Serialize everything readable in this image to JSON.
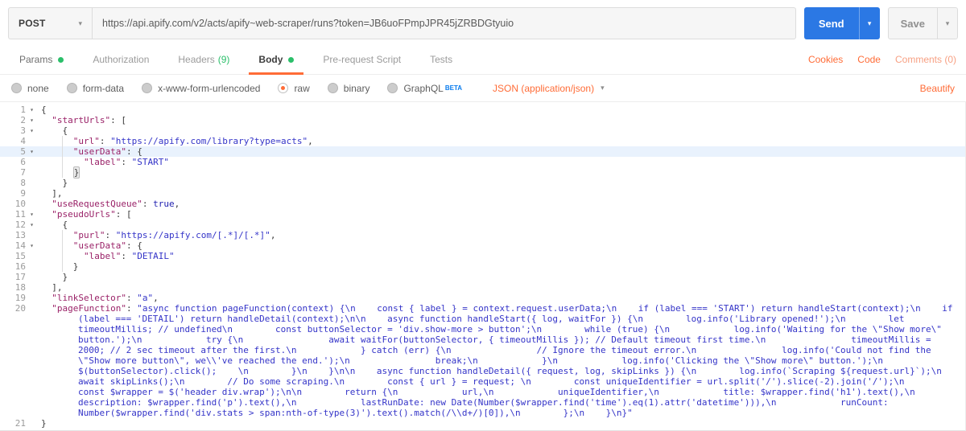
{
  "request": {
    "method": "POST",
    "url": "https://api.apify.com/v2/acts/apify~web-scraper/runs?token=JB6uoFPmpJPR45jZRBDGtyuio",
    "send_label": "Send",
    "save_label": "Save"
  },
  "tabs": [
    {
      "label": "Params",
      "dot": true,
      "first": true
    },
    {
      "label": "Authorization"
    },
    {
      "label": "Headers",
      "badge": "(9)"
    },
    {
      "label": "Body",
      "dot": true,
      "active": true
    },
    {
      "label": "Pre-request Script"
    },
    {
      "label": "Tests"
    }
  ],
  "tab_links": {
    "cookies": "Cookies",
    "code": "Code",
    "comments": "Comments (0)"
  },
  "body_modes": [
    {
      "label": "none"
    },
    {
      "label": "form-data"
    },
    {
      "label": "x-www-form-urlencoded"
    },
    {
      "label": "raw",
      "selected": true
    },
    {
      "label": "binary"
    },
    {
      "label": "GraphQL",
      "beta": "BETA"
    }
  ],
  "content_type": "JSON (application/json)",
  "beautify_label": "Beautify",
  "colors": {
    "accent_orange": "#ff6c37",
    "green_dot": "#2bbf6a",
    "send_blue": "#2b78e4",
    "beta_blue": "#097bed"
  },
  "editor": {
    "lines": [
      {
        "n": 1,
        "fold": true,
        "tokens": [
          [
            "p",
            "{"
          ]
        ]
      },
      {
        "n": 2,
        "fold": true,
        "tokens": [
          [
            "p",
            "  "
          ],
          [
            "k",
            "\"startUrls\""
          ],
          [
            "p",
            ": ["
          ]
        ]
      },
      {
        "n": 3,
        "fold": true,
        "tokens": [
          [
            "p",
            "    {"
          ]
        ]
      },
      {
        "n": 4,
        "g": true,
        "tokens": [
          [
            "p",
            "      "
          ],
          [
            "k",
            "\"url\""
          ],
          [
            "p",
            ": "
          ],
          [
            "s",
            "\"https://apify.com/library?type=acts\""
          ],
          [
            "p",
            ","
          ]
        ]
      },
      {
        "n": 5,
        "fold": true,
        "active": true,
        "g": true,
        "tokens": [
          [
            "p",
            "      "
          ],
          [
            "k",
            "\"userData\""
          ],
          [
            "p",
            ": {"
          ]
        ]
      },
      {
        "n": 6,
        "g": true,
        "tokens": [
          [
            "p",
            "        "
          ],
          [
            "k",
            "\"label\""
          ],
          [
            "p",
            ": "
          ],
          [
            "s",
            "\"START\""
          ]
        ]
      },
      {
        "n": 7,
        "g": true,
        "tokens": [
          [
            "p",
            "      "
          ],
          [
            "pm",
            "}"
          ]
        ]
      },
      {
        "n": 8,
        "tokens": [
          [
            "p",
            "    }"
          ]
        ]
      },
      {
        "n": 9,
        "tokens": [
          [
            "p",
            "  ],"
          ]
        ]
      },
      {
        "n": 10,
        "tokens": [
          [
            "p",
            "  "
          ],
          [
            "k",
            "\"useRequestQueue\""
          ],
          [
            "p",
            ": "
          ],
          [
            "a",
            "true"
          ],
          [
            "p",
            ","
          ]
        ]
      },
      {
        "n": 11,
        "fold": true,
        "tokens": [
          [
            "p",
            "  "
          ],
          [
            "k",
            "\"pseudoUrls\""
          ],
          [
            "p",
            ": ["
          ]
        ]
      },
      {
        "n": 12,
        "fold": true,
        "tokens": [
          [
            "p",
            "    {"
          ]
        ]
      },
      {
        "n": 13,
        "g": true,
        "tokens": [
          [
            "p",
            "      "
          ],
          [
            "k",
            "\"purl\""
          ],
          [
            "p",
            ": "
          ],
          [
            "s",
            "\"https://apify.com/[.*]/[.*]\""
          ],
          [
            "p",
            ","
          ]
        ]
      },
      {
        "n": 14,
        "fold": true,
        "g": true,
        "tokens": [
          [
            "p",
            "      "
          ],
          [
            "k",
            "\"userData\""
          ],
          [
            "p",
            ": {"
          ]
        ]
      },
      {
        "n": 15,
        "g": true,
        "tokens": [
          [
            "p",
            "        "
          ],
          [
            "k",
            "\"label\""
          ],
          [
            "p",
            ": "
          ],
          [
            "s",
            "\"DETAIL\""
          ]
        ]
      },
      {
        "n": 16,
        "g": true,
        "tokens": [
          [
            "p",
            "      }"
          ]
        ]
      },
      {
        "n": 17,
        "tokens": [
          [
            "p",
            "    }"
          ]
        ]
      },
      {
        "n": 18,
        "tokens": [
          [
            "p",
            "  ],"
          ]
        ]
      },
      {
        "n": 19,
        "tokens": [
          [
            "p",
            "  "
          ],
          [
            "k",
            "\"linkSelector\""
          ],
          [
            "p",
            ": "
          ],
          [
            "s",
            "\"a\""
          ],
          [
            "p",
            ","
          ]
        ]
      },
      {
        "n": 20,
        "wrap": true,
        "tokens": [
          [
            "p",
            "  "
          ],
          [
            "k",
            "\"pageFunction\""
          ],
          [
            "p",
            ": "
          ],
          [
            "s",
            "\"async function pageFunction(context) {\\n    const { label } = context.request.userData;\\n    if (label === 'START') return handleStart(context);\\n    if (label === 'DETAIL') return handleDetail(context);\\n\\n    async function handleStart({ log, waitFor }) {\\n        log.info('Library opened!');\\n        let timeoutMillis; // undefined\\n        const buttonSelector = 'div.show-more > button';\\n        while (true) {\\n            log.info('Waiting for the \\\"Show more\\\" button.');\\n            try {\\n                await waitFor(buttonSelector, { timeoutMillis }); // Default timeout first time.\\n                timeoutMillis = 2000; // 2 sec timeout after the first.\\n            } catch (err) {\\n                // Ignore the timeout error.\\n                log.info('Could not find the \\\"Show more button\\\", we\\\\'ve reached the end.');\\n                break;\\n            }\\n            log.info('Clicking the \\\"Show more\\\" button.');\\n            $(buttonSelector).click();    \\n        }\\n    }\\n\\n    async function handleDetail({ request, log, skipLinks }) {\\n        log.info(`Scraping ${request.url}`);\\n        await skipLinks();\\n        // Do some scraping.\\n        const { url } = request; \\n        const uniqueIdentifier = url.split('/').slice(-2).join('/');\\n        const $wrapper = $('header div.wrap');\\n\\n        return {\\n            url,\\n            uniqueIdentifier,\\n            title: $wrapper.find('h1').text(),\\n            description: $wrapper.find('p').text(),\\n            lastRunDate: new Date(Number($wrapper.find('time').eq(1).attr('datetime'))),\\n            runCount: Number($wrapper.find('div.stats > span:nth-of-type(3)').text().match(/\\\\d+/)[0]),\\n        };\\n    }\\n}\""
          ]
        ]
      },
      {
        "n": 21,
        "tokens": [
          [
            "p",
            "}"
          ]
        ]
      }
    ]
  }
}
